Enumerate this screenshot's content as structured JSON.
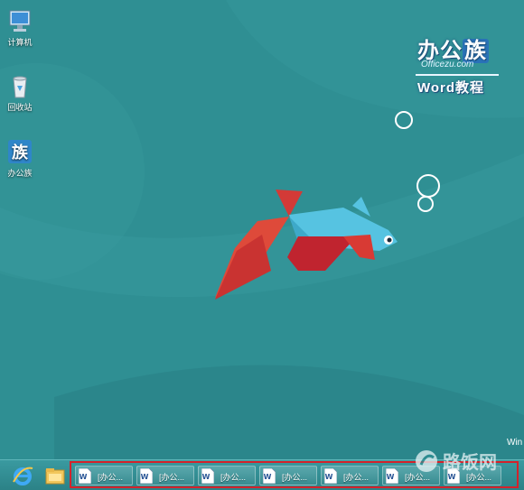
{
  "desktop": {
    "icons": [
      {
        "label": "计算机",
        "icon": "computer-icon"
      },
      {
        "label": "回收站",
        "icon": "recycle-bin-icon"
      },
      {
        "label": "办公族",
        "icon": "bangongzu-app-icon"
      }
    ],
    "brand": {
      "title_a": "办公",
      "title_b": "族",
      "domain": "Officezu.com",
      "subtitle": "Word教程"
    },
    "corner_text": "Win"
  },
  "taskbar": {
    "pinned": [
      {
        "icon": "internet-explorer-icon"
      },
      {
        "icon": "file-explorer-icon"
      }
    ],
    "windows": [
      {
        "label": "[办公...",
        "icon": "word-document-icon"
      },
      {
        "label": "[办公...",
        "icon": "word-document-icon"
      },
      {
        "label": "[办公...",
        "icon": "word-document-icon"
      },
      {
        "label": "[办公...",
        "icon": "word-document-icon"
      },
      {
        "label": "[办公...",
        "icon": "word-document-icon"
      },
      {
        "label": "[办公...",
        "icon": "word-document-icon"
      },
      {
        "label": "[办公...",
        "icon": "word-document-icon"
      }
    ]
  },
  "watermark": {
    "text": "路饭网",
    "icon": "lufan-logo-icon"
  },
  "colors": {
    "wallpaper": "#2f8f93",
    "highlight_box": "#d4222b",
    "fish_body": "#56c3e1",
    "fish_fin": "#d83a34"
  }
}
